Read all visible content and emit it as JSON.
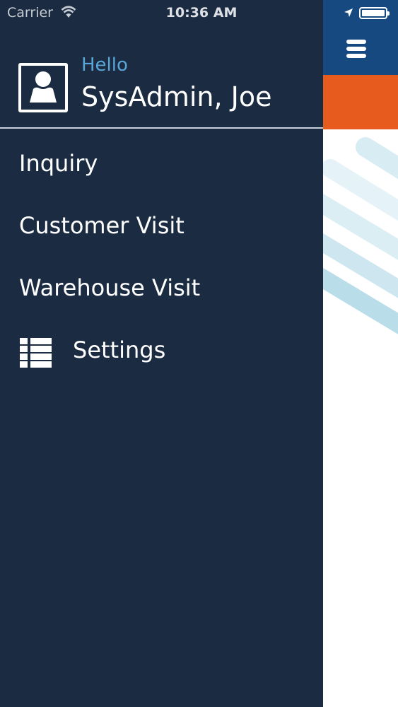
{
  "status_bar": {
    "carrier": "Carrier",
    "time": "10:36 AM",
    "icons": [
      "wifi-icon",
      "location-arrow-icon",
      "battery-icon"
    ]
  },
  "header": {
    "menu_icon": "hamburger-icon",
    "colors": {
      "header": "#15497f",
      "accent_bar": "#e85b1f"
    }
  },
  "drawer": {
    "background": "#1b2c42",
    "greeting": "Hello",
    "user_name": "SysAdmin, Joe",
    "avatar_icon": "user-avatar-icon",
    "items": [
      {
        "label": "Inquiry"
      },
      {
        "label": "Customer Visit"
      },
      {
        "label": "Warehouse Visit"
      },
      {
        "label": "Settings",
        "icon": "list-icon"
      }
    ]
  }
}
